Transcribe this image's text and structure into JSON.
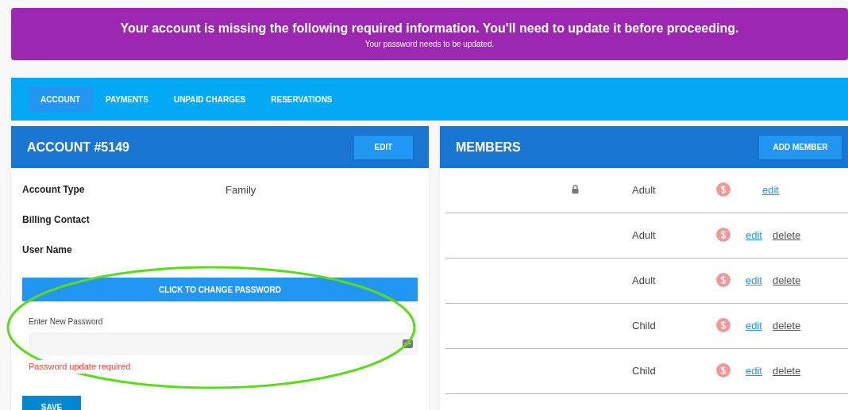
{
  "banner": {
    "title": "Your account is missing the following required information. You'll need to update it before proceeding.",
    "message": "Your password needs to be updated."
  },
  "tabs": [
    {
      "label": "ACCOUNT",
      "selected": true
    },
    {
      "label": "PAYMENTS",
      "selected": false
    },
    {
      "label": "UNPAID CHARGES",
      "selected": false
    },
    {
      "label": "RESERVATIONS",
      "selected": false
    }
  ],
  "account": {
    "title": "ACCOUNT #5149",
    "edit_button": "EDIT",
    "fields": [
      {
        "label": "Account Type",
        "value": "Family"
      },
      {
        "label": "Billing Contact"
      },
      {
        "label": "User Name"
      }
    ],
    "change_password_button": "CLICK TO CHANGE PASSWORD",
    "password_field": {
      "label": "Enter New Password",
      "error": "Password update required"
    },
    "save_button": "SAVE"
  },
  "members": {
    "title": "MEMBERS",
    "add_button": "ADD MEMBER",
    "rows": [
      {
        "locked": true,
        "type": "Adult",
        "edit": "edit"
      },
      {
        "locked": false,
        "type": "Adult",
        "edit": "edit",
        "delete": "delete"
      },
      {
        "locked": false,
        "type": "Adult",
        "edit": "edit",
        "delete": "delete"
      },
      {
        "locked": false,
        "type": "Child",
        "edit": "edit",
        "delete": "delete"
      },
      {
        "locked": false,
        "type": "Child",
        "edit": "edit",
        "delete": "delete"
      }
    ]
  },
  "annotation": {
    "kind": "ellipse",
    "color": "#5cdb1a"
  }
}
